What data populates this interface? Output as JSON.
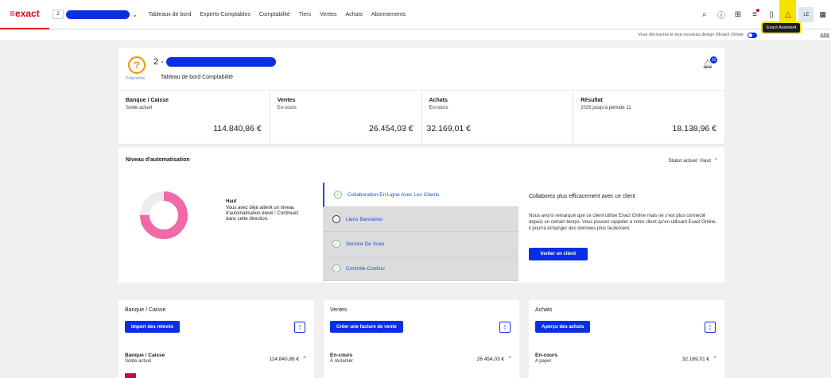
{
  "app": {
    "logo": "≡exact",
    "company_code": "2"
  },
  "nav": [
    "Tableaux de bord",
    "Experts-Comptables",
    "Comptabilité",
    "Tiers",
    "Ventes",
    "Achats",
    "Abonnements"
  ],
  "user": {
    "initials": "LE"
  },
  "colors": {
    "accent": "#0a2fe3",
    "brand": "#e2001a",
    "highlight": "#f5e400",
    "donut": "#f06aa8",
    "check": "#6cc07a"
  },
  "subbar": {
    "text": "Vous découvrez le tout nouveau design d'Exact Online",
    "link": "sulat"
  },
  "tooltip": "Exact Assistant",
  "header": {
    "brand_name": "Polynome",
    "company_prefix": "2 -",
    "title": "Tableau de bord Comptabilité",
    "notification_count": "10"
  },
  "kpis": [
    {
      "title": "Banque / Caisse",
      "sub": "Solde actuel",
      "value": "114.840,86 €"
    },
    {
      "title": "Ventes",
      "sub": "En-cours",
      "value": "26.454,03 €"
    },
    {
      "title": "Achats",
      "sub": "En-cours",
      "value": "32.169,01 €"
    },
    {
      "title": "Résultat",
      "sub": "2025 jusqu'à période 11",
      "value": "18.138,96 €"
    }
  ],
  "automation": {
    "title": "Niveau d'automatisation",
    "status": "Statut actuel: Haut",
    "level_fraction": 0.75,
    "level_label": "Haut",
    "level_text": "Vous avez déjà atteint un niveau d'automatisation élevé ! Continuez dans cette direction.",
    "steps": [
      {
        "label": "Collaboration En Ligne Avec Les Clients",
        "done": true,
        "active": true
      },
      {
        "label": "Liens Bancaires",
        "done": false,
        "active": false
      },
      {
        "label": "Service De Scan",
        "done": true,
        "active": false
      },
      {
        "label": "Contrôle Continu",
        "done": true,
        "active": false
      }
    ],
    "detail_title": "Collaborez plus efficacement avec ce client",
    "detail_text": "Nous avons remarqué que ce client utilise Exact Online mais ne s'est plus connecté depuis un certain temps. Vous pouvez rappeler à votre client qu'en utilisant Exact Online, il pourra échanger des données plus facilement.",
    "invite_label": "Inviter un client"
  },
  "cards": [
    {
      "title": "Banque / Caisse",
      "button": "Import des relevés",
      "row_title": "Banque / Caisse",
      "row_sub": "Solde actuel",
      "row_value": "114.840,86 €"
    },
    {
      "title": "Ventes",
      "button": "Créer une facture de vente",
      "row_title": "En-cours",
      "row_sub": "À réclamer",
      "row_value": "26.454,03 €"
    },
    {
      "title": "Achats",
      "button": "Aperçu des achats",
      "row_title": "En-cours",
      "row_sub": "A payer",
      "row_value": "32.169,01 €"
    }
  ]
}
